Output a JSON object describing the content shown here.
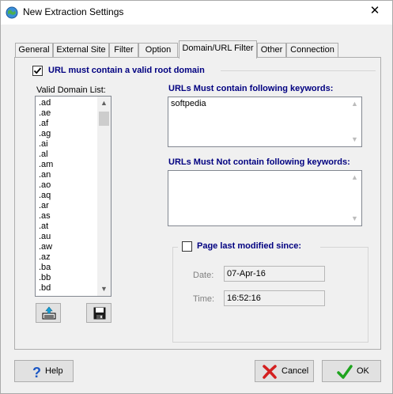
{
  "window": {
    "title": "New Extraction Settings",
    "close_glyph": "✕"
  },
  "tabs": [
    {
      "label": "General"
    },
    {
      "label": "External Site"
    },
    {
      "label": "Filter"
    },
    {
      "label": "Option"
    },
    {
      "label": "Domain/URL Filter",
      "active": true
    },
    {
      "label": "Other"
    },
    {
      "label": "Connection"
    }
  ],
  "domain_filter": {
    "root_domain_checkbox": {
      "label": "URL must contain a valid root domain",
      "checked": true
    },
    "valid_domain_list": {
      "label": "Valid Domain List:",
      "items": [
        ".ad",
        ".ae",
        ".af",
        ".ag",
        ".ai",
        ".al",
        ".am",
        ".an",
        ".ao",
        ".aq",
        ".ar",
        ".as",
        ".at",
        ".au",
        ".aw",
        ".az",
        ".ba",
        ".bb",
        ".bd"
      ]
    },
    "must_contain": {
      "label": "URLs Must contain following keywords:",
      "value": "softpedia"
    },
    "must_not_contain": {
      "label": "URLs Must Not contain following keywords:",
      "value": ""
    },
    "last_modified": {
      "checkbox_label": "Page last modified since:",
      "checked": false,
      "date_label": "Date:",
      "date_value": "07-Apr-16",
      "time_label": "Time:",
      "time_value": "16:52:16"
    }
  },
  "buttons": {
    "help": "Help",
    "cancel": "Cancel",
    "ok": "OK"
  },
  "icons": {
    "app": "globe-icon",
    "import": "import-list-icon",
    "save": "floppy-disk-icon",
    "help": "question-mark-icon",
    "cancel": "red-x-icon",
    "ok": "green-check-icon"
  },
  "colors": {
    "label_accent": "#000080",
    "window_bg": "#f0f0f0"
  }
}
